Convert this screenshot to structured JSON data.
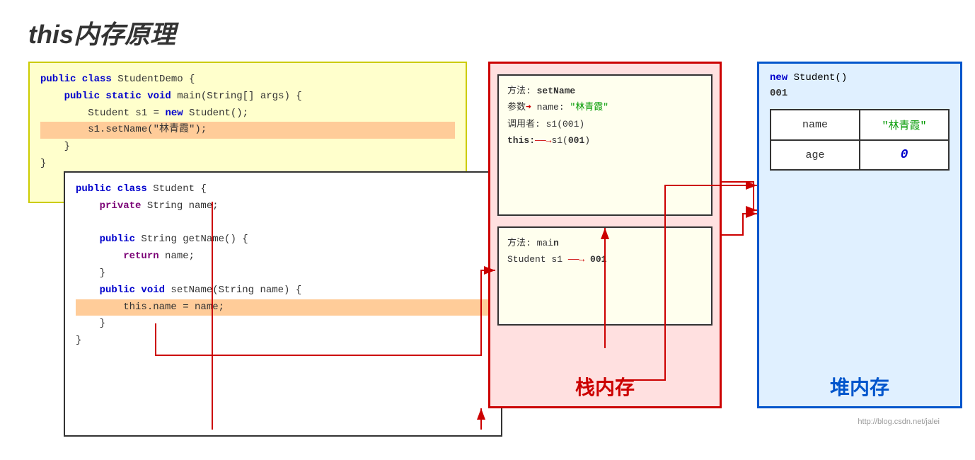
{
  "title": {
    "prefix": "this",
    "suffix": "内存原理"
  },
  "code_outer": {
    "lines": [
      {
        "text": "public class StudentDemo {",
        "keywords": [
          "public",
          "class"
        ]
      },
      {
        "text": "    public static void main(String[] args) {",
        "keywords": [
          "public",
          "static",
          "void"
        ]
      },
      {
        "text": "        Student s1 = new Student();",
        "keywords": [
          "new"
        ]
      },
      {
        "text": "        s1.setName(\"林青霞\");",
        "highlight": true
      },
      {
        "text": "    }"
      },
      {
        "text": "}"
      }
    ]
  },
  "code_inner": {
    "lines": [
      {
        "text": "public class Student {",
        "keywords": [
          "public",
          "class"
        ]
      },
      {
        "text": "    private String name;",
        "keywords": [
          "private"
        ]
      },
      {
        "text": ""
      },
      {
        "text": "    public String getName() {",
        "keywords": [
          "public",
          "String"
        ]
      },
      {
        "text": "        return name;",
        "keywords": [
          "return"
        ]
      },
      {
        "text": "    }"
      },
      {
        "text": "    public void setName(String name) {",
        "keywords": [
          "public",
          "void"
        ]
      },
      {
        "text": "        this.name = name;",
        "highlight": true
      },
      {
        "text": "    }"
      },
      {
        "text": "}"
      }
    ]
  },
  "stack": {
    "label": "栈内存",
    "frame_setname": {
      "title": "方法: setName",
      "params": "参数: name: \"林青霞\"",
      "caller": "调用者: s1(001)",
      "this_ref": "this:→s1(001)"
    },
    "frame_main": {
      "title": "方法: main",
      "var": "Student s1 ——→ 001"
    }
  },
  "heap": {
    "label": "堆内存",
    "new_title": "new Student()",
    "address": "001",
    "fields": [
      {
        "name": "name",
        "value": "\"林青霞\"",
        "type": "name"
      },
      {
        "name": "age",
        "value": "0",
        "type": "age"
      }
    ]
  },
  "watermark": "http://blog.csdn.net/jalei"
}
